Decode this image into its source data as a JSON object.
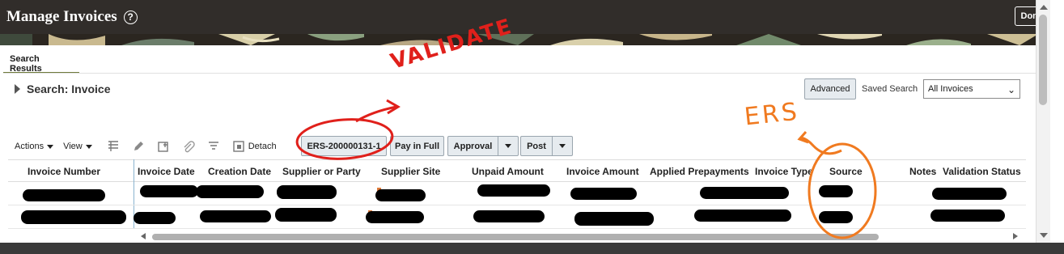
{
  "header": {
    "title": "Manage Invoices",
    "help_icon": "help-circle-icon",
    "done_label": "Done"
  },
  "tabs": [
    {
      "label": "Search Results"
    }
  ],
  "search": {
    "title": "Search: Invoice",
    "advanced_label": "Advanced",
    "saved_search_label": "Saved Search",
    "saved_search_value": "All Invoices"
  },
  "toolbar": {
    "actions_label": "Actions",
    "view_label": "View",
    "detach_label": "Detach",
    "ers_invoice_label": "ERS-200000131-1",
    "pay_in_full_label": "Pay in Full",
    "approval_label": "Approval",
    "post_label": "Post",
    "icons": [
      "freeze-icon",
      "edit-icon",
      "export-icon",
      "attachment-icon",
      "filter-icon",
      "detach-icon"
    ]
  },
  "table": {
    "columns": [
      "Invoice Number",
      "Invoice Date",
      "Creation Date",
      "Supplier or Party",
      "Supplier Site",
      "Unpaid Amount",
      "Invoice Amount",
      "Applied Prepayments",
      "Invoice Type",
      "Source",
      "Notes",
      "Validation Status"
    ],
    "rows_redacted": true
  },
  "annotations": {
    "validate_text": "VALIDATE",
    "ers_text": "ERS",
    "validate_color": "#e0201b",
    "ers_color": "#f07a20"
  },
  "colors": {
    "header_bg": "#312d2a",
    "button_bg": "#e6ebef",
    "tab_underline": "#6f7b3c"
  }
}
